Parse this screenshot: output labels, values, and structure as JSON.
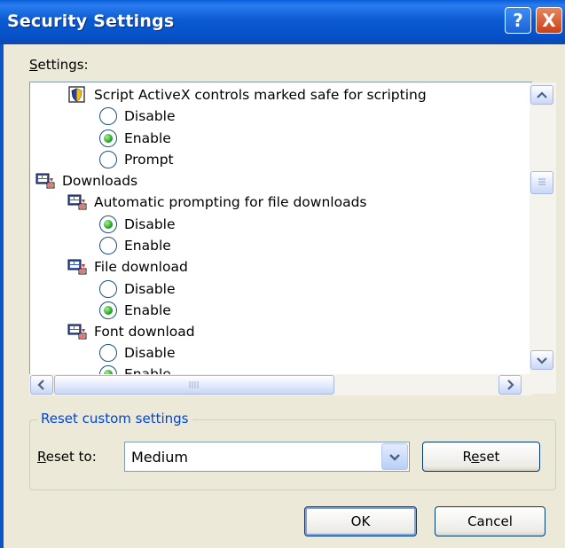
{
  "window": {
    "title": "Security Settings",
    "help_glyph": "?",
    "close_glyph": "X"
  },
  "settings_label_first": "S",
  "settings_label_rest": "ettings:",
  "tree": [
    {
      "kind": "setting",
      "icon": "shield-checkbox-icon",
      "label": "Script ActiveX controls marked safe for scripting"
    },
    {
      "kind": "option",
      "label": "Disable",
      "selected": false
    },
    {
      "kind": "option",
      "label": "Enable",
      "selected": true
    },
    {
      "kind": "option",
      "label": "Prompt",
      "selected": false
    },
    {
      "kind": "category",
      "icon": "downloads-settings-icon",
      "label": "Downloads"
    },
    {
      "kind": "setting",
      "icon": "downloads-settings-icon",
      "label": "Automatic prompting for file downloads"
    },
    {
      "kind": "option",
      "label": "Disable",
      "selected": true
    },
    {
      "kind": "option",
      "label": "Enable",
      "selected": false
    },
    {
      "kind": "setting",
      "icon": "downloads-settings-icon",
      "label": "File download"
    },
    {
      "kind": "option",
      "label": "Disable",
      "selected": false
    },
    {
      "kind": "option",
      "label": "Enable",
      "selected": true
    },
    {
      "kind": "setting",
      "icon": "downloads-settings-icon",
      "label": "Font download"
    },
    {
      "kind": "option",
      "label": "Disable",
      "selected": false
    },
    {
      "kind": "option",
      "label": "Enable",
      "selected": true
    }
  ],
  "scroll": {
    "up_icon": "arrow-up-icon",
    "down_icon": "arrow-down-icon",
    "left_icon": "arrow-left-icon",
    "right_icon": "arrow-right-icon",
    "vertical_position": 0.3,
    "horizontal_position": 0.0
  },
  "reset": {
    "group_title": "Reset custom settings",
    "reset_to_first": "R",
    "reset_to_rest": "eset to:",
    "selected_value": "Medium",
    "button_first": "R",
    "button_underlined": "e",
    "button_rest": "set"
  },
  "buttons": {
    "ok": "OK",
    "cancel": "Cancel"
  },
  "colors": {
    "title_bar": "#0a5fd8",
    "dialog_bg": "#ece9d8",
    "group_title": "#0046d5",
    "radio_selected": "#21a121"
  }
}
